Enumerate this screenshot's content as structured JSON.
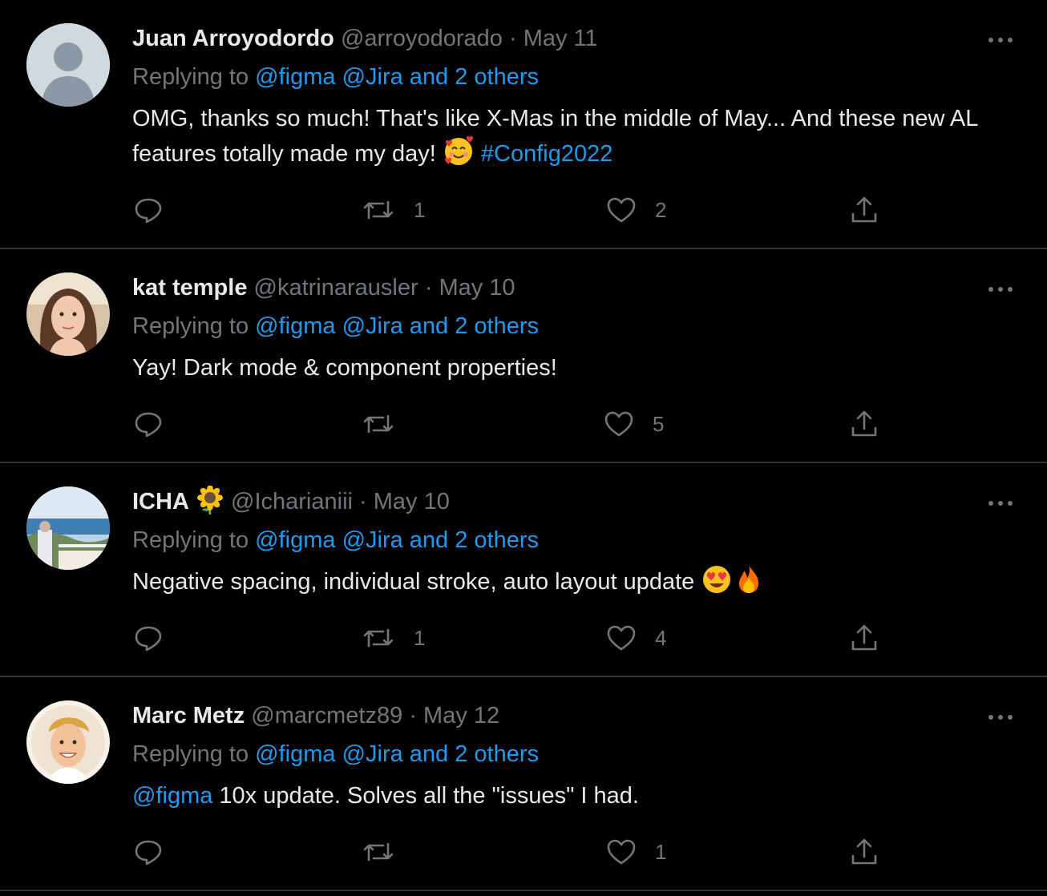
{
  "tweets": [
    {
      "name": "Juan Arroyodordo",
      "handle": "@arroyodorado",
      "sep": "·",
      "date": "May 11",
      "replying_prefix": "Replying to",
      "replying_links": "@figma @Jira and 2 others",
      "text_main": "OMG, thanks so much! That's like X-Mas in the middle of May... And these new AL features totally made my day!",
      "hashtag": "#Config2022",
      "emoji": "smiling-face-with-hearts",
      "retweets": "1",
      "likes": "2"
    },
    {
      "name": "kat temple",
      "handle": "@katrinarausler",
      "sep": "·",
      "date": "May 10",
      "replying_prefix": "Replying to",
      "replying_links": "@figma @Jira and 2 others",
      "text_main": "Yay! Dark mode & component properties!",
      "retweets": "",
      "likes": "5"
    },
    {
      "name": "ICHA",
      "name_emoji": "sunflower",
      "handle": "@Icharianiii",
      "sep": "·",
      "date": "May 10",
      "replying_prefix": "Replying to",
      "replying_links": "@figma @Jira and 2 others",
      "text_main": "Negative spacing, individual stroke, auto layout update",
      "emoji": [
        "heart-eyes",
        "fire"
      ],
      "retweets": "1",
      "likes": "4"
    },
    {
      "name": "Marc Metz",
      "handle": "@marcmetz89",
      "sep": "·",
      "date": "May 12",
      "replying_prefix": "Replying to",
      "replying_links": "@figma @Jira and 2 others",
      "mention": "@figma",
      "text_main": "10x update. Solves all the \"issues\" I had.",
      "retweets": "",
      "likes": "1"
    }
  ],
  "colors": {
    "background": "#000000",
    "text": "#e7e9ea",
    "muted": "#71767b",
    "link": "#1d9bf0",
    "divider": "#2f3336"
  }
}
